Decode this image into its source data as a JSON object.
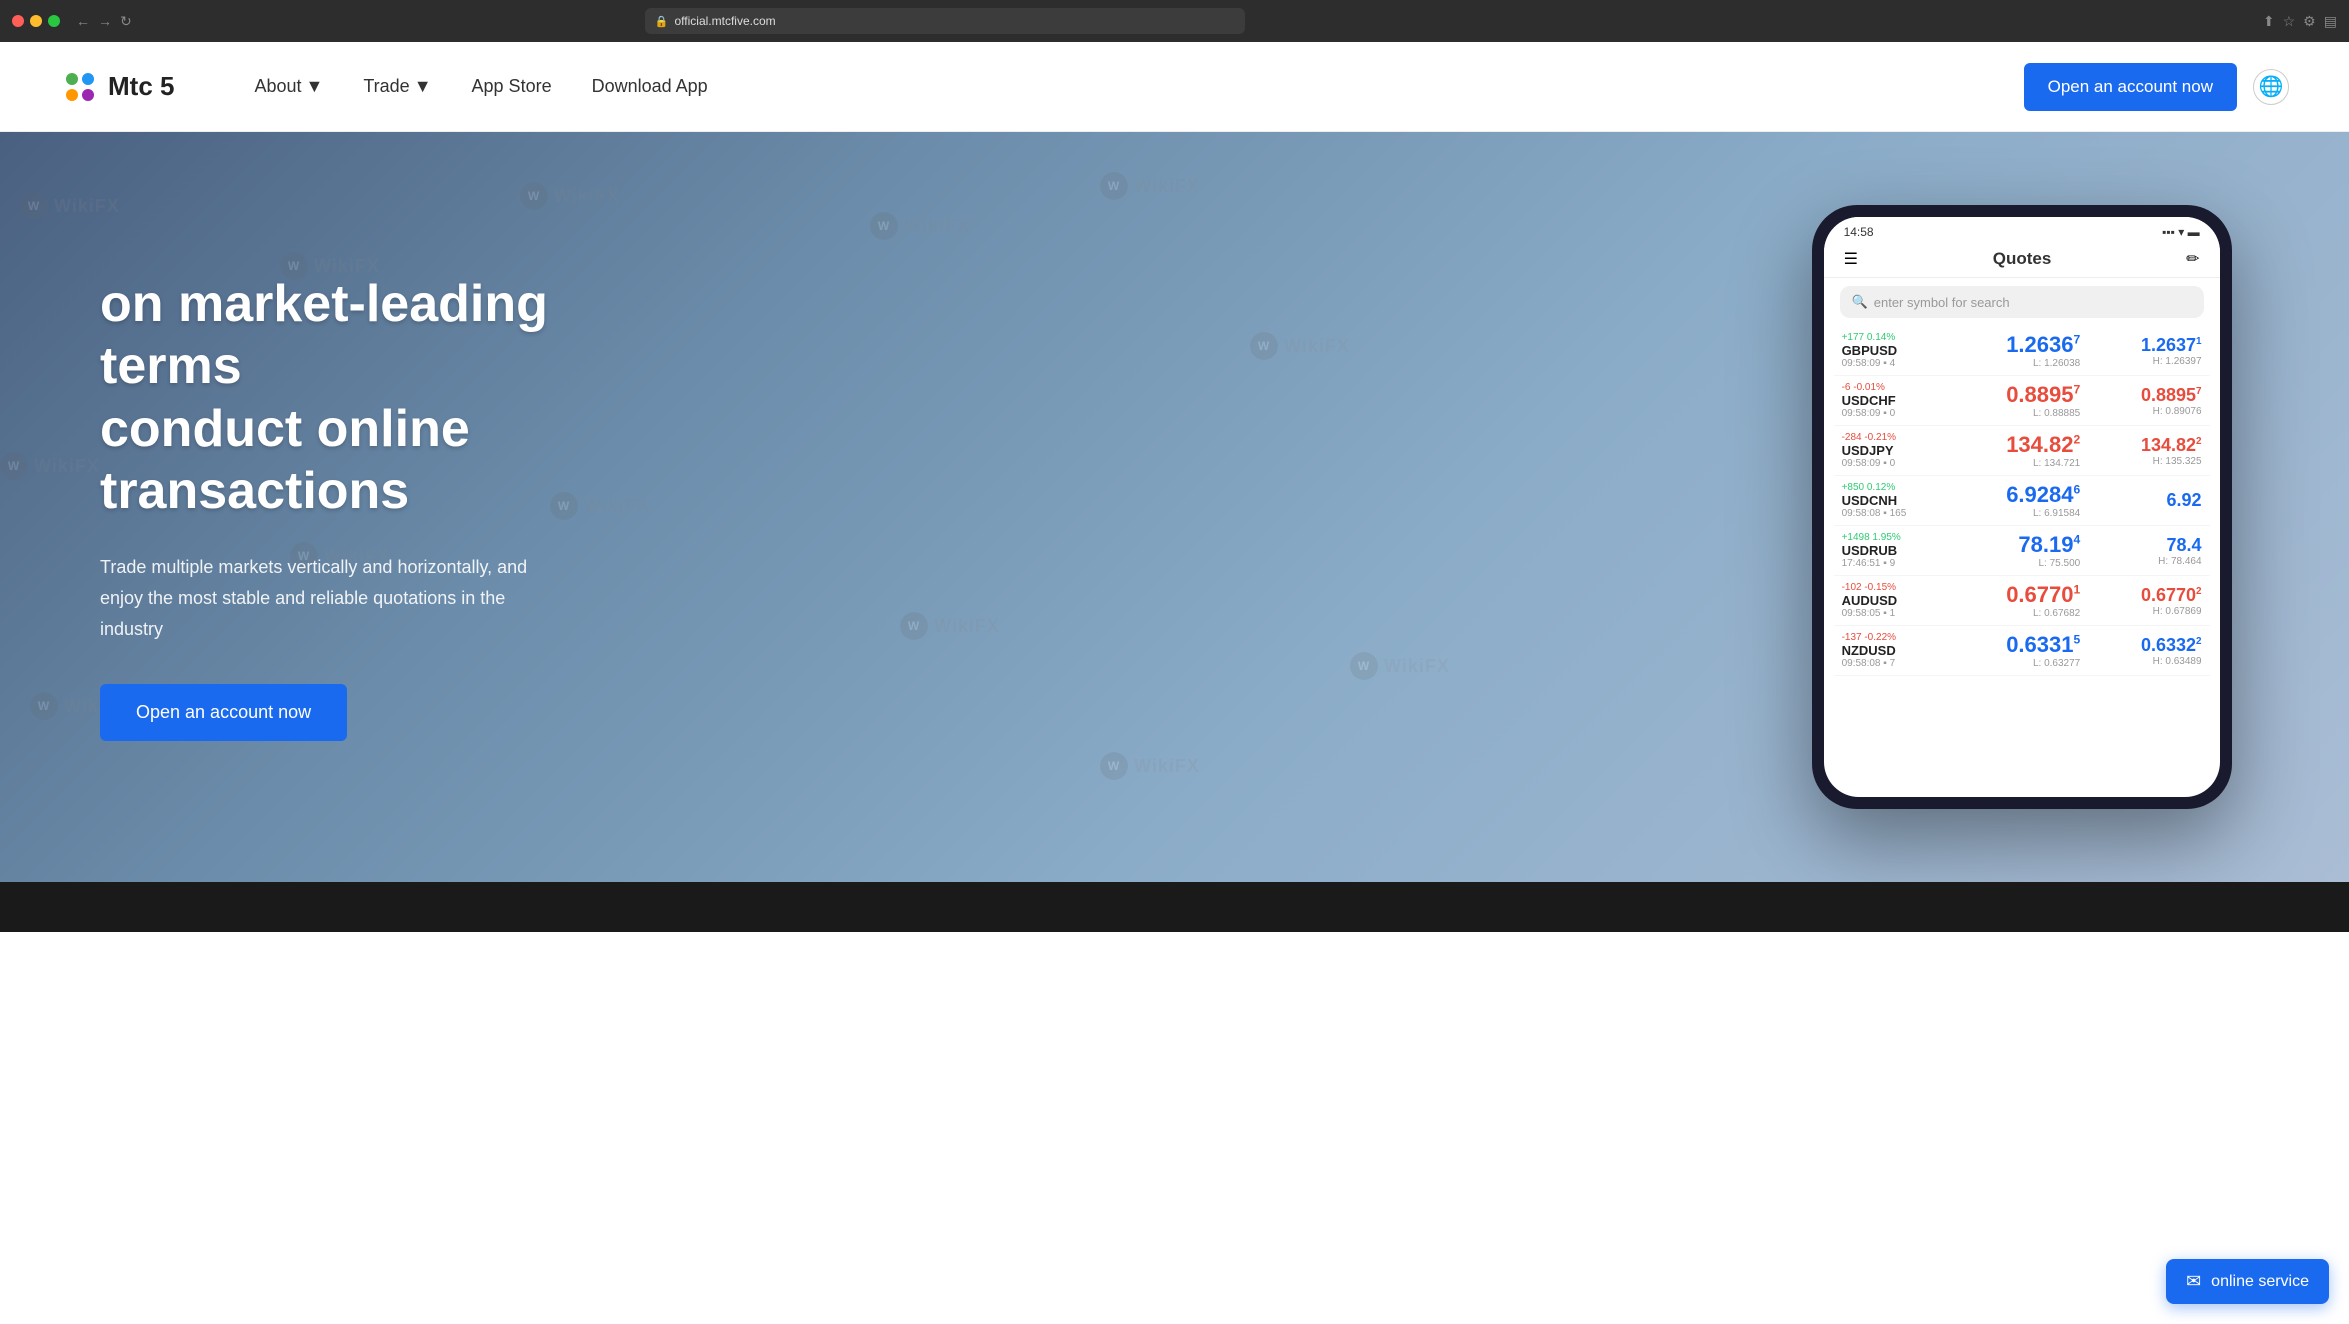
{
  "browser": {
    "url": "official.mtcfive.com",
    "controls": {
      "close": "×",
      "minimize": "−",
      "maximize": "□"
    }
  },
  "navbar": {
    "logo_text": "Mtc 5",
    "nav_items": [
      {
        "label": "About",
        "has_dropdown": true
      },
      {
        "label": "Trade",
        "has_dropdown": true
      },
      {
        "label": "App Store",
        "has_dropdown": false
      },
      {
        "label": "Download App",
        "has_dropdown": false
      }
    ],
    "cta_button": "Open an account now",
    "globe_label": "Language"
  },
  "hero": {
    "title_line1": "on market-leading terms",
    "title_line2": "conduct online",
    "title_line3": "transactions",
    "subtitle": "Trade multiple markets vertically and horizontally, and enjoy the most stable and reliable quotations in the industry",
    "cta_button": "Open an account now"
  },
  "phone": {
    "time": "14:58",
    "header_title": "Quotes",
    "search_placeholder": "enter symbol for search",
    "quotes": [
      {
        "symbol": "GBPUSD",
        "time": "09:58:09",
        "change": "+177 0.14%",
        "change_type": "pos",
        "bid": "1.2636",
        "bid_sup": "7",
        "ask": "1.2637",
        "ask_sup": "1",
        "low": "L: 1.26038",
        "high": "H: 1.26397",
        "color": "blue"
      },
      {
        "symbol": "USDCHF",
        "time": "09:58:09",
        "change": "-6 -0.01%",
        "change_type": "neg",
        "bid": "0.8895",
        "bid_sup": "7",
        "ask": "0.8895",
        "ask_sup": "7",
        "low": "L: 0.88885",
        "high": "H: 0.89076",
        "color": "red"
      },
      {
        "symbol": "USDJPY",
        "time": "09:58:09",
        "change": "-284 -0.21%",
        "change_type": "neg",
        "bid": "134.82",
        "bid_sup": "2",
        "ask": "134.82",
        "ask_sup": "2",
        "low": "L: 134.721",
        "high": "H: 135.325",
        "color": "red"
      },
      {
        "symbol": "USDCNH",
        "time": "09:58:08",
        "change": "+850 0.12%",
        "change_type": "pos",
        "bid": "6.9284",
        "bid_sup": "6",
        "ask": "6.92",
        "ask_sup": "",
        "low": "L: 6.91584",
        "high": "",
        "color": "blue"
      },
      {
        "symbol": "USDRUB",
        "time": "17:46:51",
        "change": "+1498 1.95%",
        "change_type": "pos",
        "bid": "78.19",
        "bid_sup": "4",
        "ask": "78.4",
        "ask_sup": "",
        "low": "L: 75.500",
        "high": "H: 78.464",
        "color": "blue"
      },
      {
        "symbol": "AUDUSD",
        "time": "09:58:05",
        "change": "-102 -0.15%",
        "change_type": "neg",
        "bid": "0.6770",
        "bid_sup": "1",
        "ask": "0.6770",
        "ask_sup": "2",
        "low": "L: 0.67682",
        "high": "H: 0.67869",
        "color": "red"
      },
      {
        "symbol": "NZDUSD",
        "time": "09:58:08",
        "change": "-137 -0.22%",
        "change_type": "neg",
        "bid": "0.6331",
        "bid_sup": "5",
        "ask": "0.6332",
        "ask_sup": "2",
        "low": "L: 0.63277",
        "high": "H: 0.63489",
        "color": "blue"
      }
    ]
  },
  "online_service": {
    "label": "online service",
    "icon": "💬"
  },
  "colors": {
    "primary": "#1a6af0",
    "price_blue": "#1a6af0",
    "price_red": "#e74c3c",
    "bg_dark": "#2d2d2d",
    "hero_bg_start": "#4a6080",
    "hero_bg_end": "#8bacc8"
  }
}
